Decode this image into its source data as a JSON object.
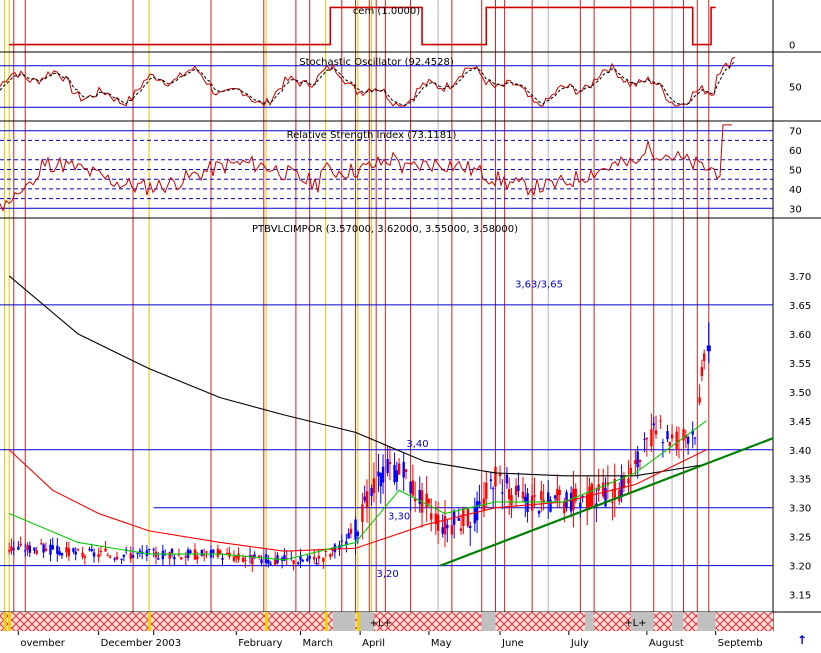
{
  "chart_data": [
    {
      "type": "line",
      "panel": "cem",
      "title": "cem (1.0000)",
      "ylim": [
        -0.2,
        1.2
      ],
      "ticks": [
        0
      ],
      "segments": [
        {
          "from": "2002-11-01",
          "to": "2003-03-21",
          "value": 0
        },
        {
          "from": "2003-03-21",
          "to": "2003-04-30",
          "value": 1
        },
        {
          "from": "2003-04-30",
          "to": "2003-05-28",
          "value": 0
        },
        {
          "from": "2003-05-28",
          "to": "2003-08-26",
          "value": 1
        },
        {
          "from": "2003-08-26",
          "to": "2003-09-03",
          "value": 0
        },
        {
          "from": "2003-09-03",
          "to": "2003-09-05",
          "value": 1
        }
      ]
    },
    {
      "type": "line",
      "panel": "stochastic",
      "title": "Stochastic Oscillator (92.4528)",
      "ylim": [
        0,
        100
      ],
      "ticks": [
        50
      ],
      "hlines": [
        20,
        80
      ],
      "last": 92.4528
    },
    {
      "type": "line",
      "panel": "rsi",
      "title": "Relative Strength Index (73.1181)",
      "ylim": [
        25,
        75
      ],
      "ticks": [
        30,
        40,
        50,
        60,
        70
      ],
      "solid_lines": [
        30,
        70
      ],
      "dashed_lines": [
        35,
        40,
        45,
        50,
        55,
        65
      ],
      "last": 73.1181
    },
    {
      "type": "line",
      "panel": "price",
      "title": "PTBVLCIMPOR (3.57000, 3.62000, 3.55000, 3.58000)",
      "ylim": [
        3.12,
        3.8
      ],
      "ticks": [
        "3.15",
        "3.20",
        "3.25",
        "3.30",
        "3.35",
        "3.40",
        "3.45",
        "3.50",
        "3.55",
        "3.60",
        "3.65",
        "3.70"
      ],
      "hlines": [
        3.2,
        3.3,
        3.4,
        3.65
      ],
      "annotations": [
        {
          "text": "3,63/3,65",
          "date": "2003-06-20",
          "price": 3.68
        },
        {
          "text": "3,40",
          "date": "2003-04-28",
          "price": 3.405
        },
        {
          "text": "3,30",
          "date": "2003-04-20",
          "price": 3.28
        },
        {
          "text": "3,20",
          "date": "2003-04-15",
          "price": 3.18
        }
      ],
      "trendline": {
        "from": {
          "date": "2003-05-08",
          "price": 3.2
        },
        "to": {
          "date": "2003-09-30",
          "price": 3.42
        }
      },
      "series": [
        {
          "kind": "close",
          "points": [
            [
              "2002-11-01",
              3.23
            ],
            [
              "2002-11-15",
              3.23
            ],
            [
              "2002-12-01",
              3.22
            ],
            [
              "2002-12-15",
              3.22
            ],
            [
              "2003-01-01",
              3.22
            ],
            [
              "2003-01-15",
              3.22
            ],
            [
              "2003-02-01",
              3.22
            ],
            [
              "2003-02-15",
              3.21
            ],
            [
              "2003-03-01",
              3.21
            ],
            [
              "2003-03-15",
              3.21
            ],
            [
              "2003-03-25",
              3.23
            ],
            [
              "2003-04-01",
              3.26
            ],
            [
              "2003-04-08",
              3.32
            ],
            [
              "2003-04-15",
              3.37
            ],
            [
              "2003-04-22",
              3.36
            ],
            [
              "2003-05-01",
              3.31
            ],
            [
              "2003-05-10",
              3.27
            ],
            [
              "2003-05-20",
              3.28
            ],
            [
              "2003-05-26",
              3.3
            ],
            [
              "2003-06-01",
              3.36
            ],
            [
              "2003-06-10",
              3.32
            ],
            [
              "2003-06-20",
              3.31
            ],
            [
              "2003-07-01",
              3.31
            ],
            [
              "2003-07-15",
              3.32
            ],
            [
              "2003-07-25",
              3.33
            ],
            [
              "2003-08-01",
              3.37
            ],
            [
              "2003-08-10",
              3.43
            ],
            [
              "2003-08-20",
              3.42
            ],
            [
              "2003-08-28",
              3.44
            ],
            [
              "2003-09-01",
              3.58
            ]
          ]
        },
        {
          "kind": "long_ma",
          "points": [
            [
              "2002-11-01",
              3.7
            ],
            [
              "2002-12-01",
              3.6
            ],
            [
              "2003-01-01",
              3.54
            ],
            [
              "2003-02-01",
              3.49
            ],
            [
              "2003-03-01",
              3.46
            ],
            [
              "2003-04-01",
              3.43
            ],
            [
              "2003-05-01",
              3.38
            ],
            [
              "2003-06-01",
              3.36
            ],
            [
              "2003-07-01",
              3.355
            ],
            [
              "2003-08-01",
              3.355
            ],
            [
              "2003-09-01",
              3.375
            ]
          ]
        },
        {
          "kind": "mid_ma",
          "points": [
            [
              "2002-11-01",
              3.4
            ],
            [
              "2002-11-20",
              3.33
            ],
            [
              "2002-12-10",
              3.29
            ],
            [
              "2003-01-01",
              3.26
            ],
            [
              "2003-02-01",
              3.24
            ],
            [
              "2003-03-01",
              3.225
            ],
            [
              "2003-04-01",
              3.23
            ],
            [
              "2003-05-01",
              3.27
            ],
            [
              "2003-06-01",
              3.3
            ],
            [
              "2003-07-01",
              3.31
            ],
            [
              "2003-08-01",
              3.34
            ],
            [
              "2003-09-01",
              3.4
            ]
          ]
        },
        {
          "kind": "short_ma",
          "points": [
            [
              "2002-11-01",
              3.29
            ],
            [
              "2002-12-01",
              3.24
            ],
            [
              "2003-01-01",
              3.22
            ],
            [
              "2003-02-01",
              3.22
            ],
            [
              "2003-03-01",
              3.21
            ],
            [
              "2003-04-01",
              3.24
            ],
            [
              "2003-04-20",
              3.33
            ],
            [
              "2003-05-10",
              3.29
            ],
            [
              "2003-06-01",
              3.31
            ],
            [
              "2003-07-01",
              3.31
            ],
            [
              "2003-08-01",
              3.36
            ],
            [
              "2003-09-01",
              3.45
            ]
          ]
        }
      ]
    }
  ],
  "x_axis": {
    "labels": [
      {
        "text": "ovember",
        "date": "2002-11-05"
      },
      {
        "text": "December",
        "date": "2002-12-10"
      },
      {
        "text": "2003",
        "date": "2003-01-03"
      },
      {
        "text": "February",
        "date": "2003-02-08"
      },
      {
        "text": "March",
        "date": "2003-03-08"
      },
      {
        "text": "April",
        "date": "2003-04-03"
      },
      {
        "text": "May",
        "date": "2003-05-03"
      },
      {
        "text": "June",
        "date": "2003-06-03"
      },
      {
        "text": "July",
        "date": "2003-07-03"
      },
      {
        "text": "August",
        "date": "2003-08-06"
      },
      {
        "text": "Septemb",
        "date": "2003-09-05"
      }
    ],
    "markers": [
      {
        "text": "+L+",
        "date": "2003-04-12"
      },
      {
        "text": "+L+",
        "date": "2003-08-01"
      }
    ],
    "start": "2002-10-28",
    "end": "2003-09-30"
  },
  "vertical_lines": {
    "yellow": [
      "2002-10-30",
      "2002-11-01",
      "2003-01-01",
      "2003-02-21",
      "2003-03-19",
      "2003-04-02",
      "2003-04-08"
    ],
    "red": [
      "2002-11-03",
      "2002-11-08",
      "2002-12-25",
      "2003-01-28",
      "2003-02-20",
      "2003-03-06",
      "2003-03-12",
      "2003-03-26",
      "2003-04-01",
      "2003-04-07",
      "2003-04-10",
      "2003-04-14",
      "2003-04-25",
      "2003-05-13",
      "2003-05-26",
      "2003-06-01",
      "2003-06-05",
      "2003-06-17",
      "2003-07-08",
      "2003-07-14",
      "2003-07-30",
      "2003-08-09",
      "2003-08-22",
      "2003-08-28",
      "2003-09-02"
    ],
    "gray": [
      "2003-05-07",
      "2003-06-24",
      "2003-08-17"
    ]
  },
  "colors": {
    "panel_line": "#cc0000",
    "signal_dashed": "#000000",
    "hline": "#0000cc",
    "candle_up": "#0000ff",
    "candle_down": "#ff0000",
    "long_ma": "#000000",
    "mid_ma": "#ff0000",
    "short_ma": "#00cc00",
    "trendline": "#008000",
    "annotation": "#0000cc"
  },
  "ui": {
    "scroll_arrow": "↑"
  }
}
